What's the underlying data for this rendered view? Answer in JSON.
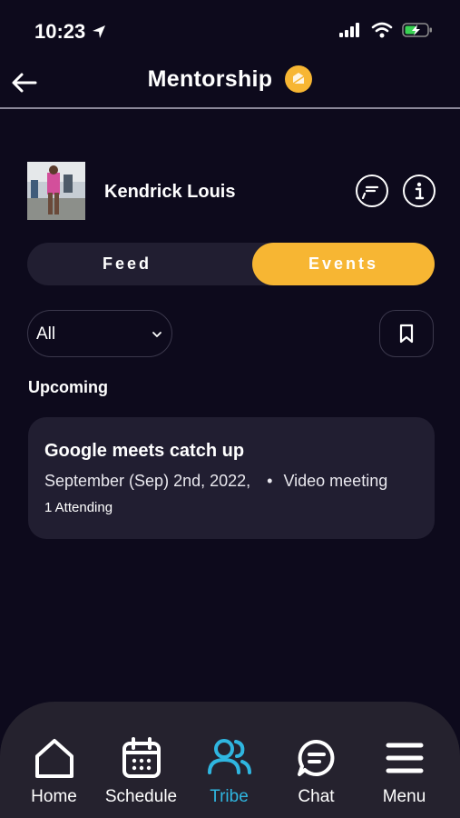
{
  "status": {
    "time": "10:23"
  },
  "header": {
    "title": "Mentorship"
  },
  "profile": {
    "name": "Kendrick Louis"
  },
  "tabs": [
    {
      "label": "Feed",
      "active": false
    },
    {
      "label": "Events",
      "active": true
    }
  ],
  "filter": {
    "selected": "All"
  },
  "section": {
    "title": "Upcoming"
  },
  "event": {
    "title": "Google meets catch up",
    "date": "September (Sep) 2nd, 2022,",
    "separator": "•",
    "type": "Video meeting",
    "attending": "1 Attending"
  },
  "nav": [
    {
      "label": "Home",
      "icon": "home-icon",
      "active": false
    },
    {
      "label": "Schedule",
      "icon": "calendar-icon",
      "active": false
    },
    {
      "label": "Tribe",
      "icon": "people-icon",
      "active": true
    },
    {
      "label": "Chat",
      "icon": "chat-icon",
      "active": false
    },
    {
      "label": "Menu",
      "icon": "menu-icon",
      "active": false
    }
  ],
  "colors": {
    "background": "#0d0a1c",
    "accent": "#f7b633",
    "active_nav": "#2fb6e0",
    "card": "#211e31"
  }
}
